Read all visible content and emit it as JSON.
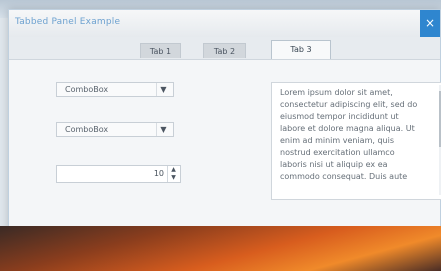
{
  "window": {
    "title": "Tabbed Panel Example",
    "close_glyph": "×"
  },
  "tabs": [
    {
      "label": "Tab 1"
    },
    {
      "label": "Tab 2"
    },
    {
      "label": "Tab 3",
      "active": true
    }
  ],
  "combos": [
    {
      "label": "ComboBox"
    },
    {
      "label": "ComboBox"
    }
  ],
  "spinbox": {
    "value": "10",
    "up_glyph": "▲",
    "down_glyph": "▼"
  },
  "textarea": {
    "lines": [
      "Lorem ipsum dolor sit amet,",
      "consectetur adipiscing elit, sed do",
      "eiusmod tempor incididunt ut",
      "labore et dolore magna aliqua. Ut",
      "enim ad minim veniam, quis",
      "nostrud exercitation ullamco",
      "laboris nisi ut aliquip ex ea",
      "commodo consequat. Duis aute"
    ]
  },
  "colors": {
    "accent": "#2f86cf",
    "title_text": "#6ea2d0"
  },
  "icons": {
    "close": "close-icon",
    "combo_arrow": "chevron-down-icon",
    "spin_up": "chevron-up-icon",
    "spin_down": "chevron-down-icon"
  }
}
